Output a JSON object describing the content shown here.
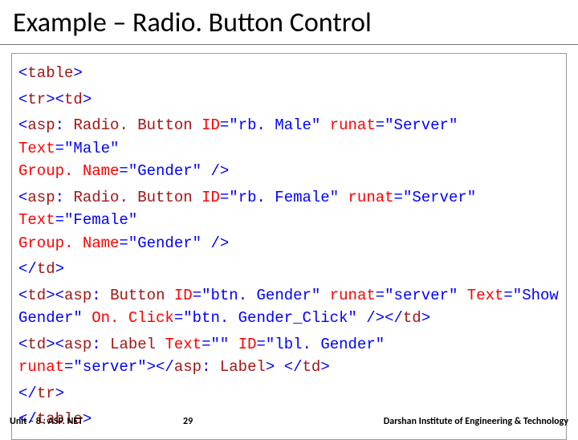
{
  "title": "Example – Radio. Button Control",
  "code": {
    "l1_a": "<",
    "l1_b": "table",
    "l1_c": ">",
    "l2_a": "<",
    "l2_b": "tr",
    "l2_c": "><",
    "l2_d": "td",
    "l2_e": ">",
    "l3_a": "<",
    "l3_b": "asp",
    "l3_c": ": ",
    "l3_d": "Radio. Button ",
    "l3_e": "ID",
    "l3_f": "=\"rb. Male\" ",
    "l3_g": "runat",
    "l3_h": "=\"Server\" ",
    "l3_i": "Text",
    "l3_j": "=\"Male\" ",
    "l4_a": "Group. Name",
    "l4_b": "=\"Gender\" />",
    "l5_a": "<",
    "l5_b": "asp",
    "l5_c": ": ",
    "l5_d": "Radio. Button ",
    "l5_e": "ID",
    "l5_f": "=\"rb. Female\" ",
    "l5_g": "runat",
    "l5_h": "=\"Server\" ",
    "l5_i": "Text",
    "l5_j": "=\"Female\" ",
    "l6_a": "Group. Name",
    "l6_b": "=\"Gender\" />",
    "l7_a": "</",
    "l7_b": "td",
    "l7_c": ">",
    "l8_a": "<",
    "l8_b": "td",
    "l8_c": "><",
    "l8_d": "asp",
    "l8_e": ": ",
    "l8_f": "Button ",
    "l8_g": "ID",
    "l8_h": "=\"btn. Gender\" ",
    "l8_i": "runat",
    "l8_j": "=\"server\" ",
    "l8_k": "Text",
    "l8_l": "=\"Show ",
    "l9_a": "Gender\" ",
    "l9_b": "On. Click",
    "l9_c": "=\"btn. Gender_Click\" /></",
    "l9_d": "td",
    "l9_e": ">",
    "l10_a": "<",
    "l10_b": "td",
    "l10_c": "><",
    "l10_d": "asp",
    "l10_e": ": ",
    "l10_f": "Label ",
    "l10_g": "Text",
    "l10_h": "=\"\" ",
    "l10_i": "ID",
    "l10_j": "=\"lbl. Gender\" ",
    "l11_a": "runat",
    "l11_b": "=\"server\"></",
    "l11_c": "asp",
    "l11_d": ": ",
    "l11_e": "Label",
    "l11_f": "> </",
    "l11_g": "td",
    "l11_h": ">",
    "l12_a": "</",
    "l12_b": "tr",
    "l12_c": ">",
    "l13_a": "</",
    "l13_b": "table",
    "l13_c": ">"
  },
  "footer": {
    "unit": "Unit – 8 : ASP. NET",
    "page": "29",
    "org": "Darshan Institute of Engineering & Technology"
  }
}
